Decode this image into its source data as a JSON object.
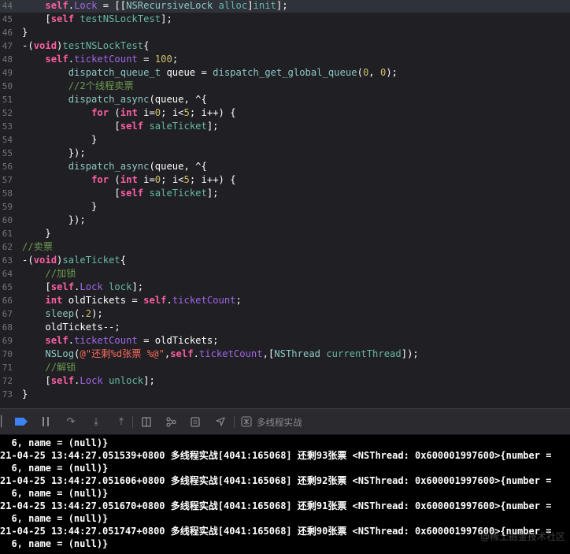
{
  "editor": {
    "lines": [
      {
        "n": "44",
        "toks": [
          [
            "    ",
            "w"
          ],
          [
            "self",
            "k"
          ],
          [
            ".",
            "w"
          ],
          [
            "Lock",
            "p"
          ],
          [
            " = [[",
            "w"
          ],
          [
            "NSRecursiveLock",
            "pr"
          ],
          [
            " ",
            "w"
          ],
          [
            "alloc",
            "m"
          ],
          [
            "]",
            "w"
          ],
          [
            "init",
            "m"
          ],
          [
            "];",
            "w"
          ]
        ]
      },
      {
        "n": "45",
        "toks": [
          [
            "    [",
            "w"
          ],
          [
            "self",
            "k"
          ],
          [
            " ",
            "w"
          ],
          [
            "testNSLockTest",
            "m"
          ],
          [
            "];",
            "w"
          ]
        ]
      },
      {
        "n": "46",
        "toks": [
          [
            "}",
            "w"
          ]
        ]
      },
      {
        "n": "47",
        "toks": [
          [
            "-(",
            "w"
          ],
          [
            "void",
            "k"
          ],
          [
            ")",
            "w"
          ],
          [
            "testNSLockTest",
            "m"
          ],
          [
            "{",
            "w"
          ]
        ]
      },
      {
        "n": "48",
        "toks": [
          [
            "    ",
            "w"
          ],
          [
            "self",
            "k"
          ],
          [
            ".",
            "w"
          ],
          [
            "ticketCount",
            "p"
          ],
          [
            " = ",
            "w"
          ],
          [
            "100",
            "n"
          ],
          [
            ";",
            "w"
          ]
        ]
      },
      {
        "n": "49",
        "toks": [
          [
            "        ",
            "w"
          ],
          [
            "dispatch_queue_t",
            "pr"
          ],
          [
            " queue = ",
            "w"
          ],
          [
            "dispatch_get_global_queue",
            "pr"
          ],
          [
            "(",
            "w"
          ],
          [
            "0",
            "n"
          ],
          [
            ", ",
            "w"
          ],
          [
            "0",
            "n"
          ],
          [
            ");",
            "w"
          ]
        ]
      },
      {
        "n": "50",
        "toks": [
          [
            "        ",
            "w"
          ],
          [
            "//2个线程卖票",
            "c"
          ]
        ]
      },
      {
        "n": "51",
        "toks": [
          [
            "        ",
            "w"
          ],
          [
            "dispatch_async",
            "pr"
          ],
          [
            "(queue, ^{",
            "w"
          ]
        ]
      },
      {
        "n": "52",
        "toks": [
          [
            "            ",
            "w"
          ],
          [
            "for",
            "k"
          ],
          [
            " (",
            "w"
          ],
          [
            "int",
            "k"
          ],
          [
            " i=",
            "w"
          ],
          [
            "0",
            "n"
          ],
          [
            "; i<",
            "w"
          ],
          [
            "5",
            "n"
          ],
          [
            "; i++) {",
            "w"
          ]
        ]
      },
      {
        "n": "53",
        "toks": [
          [
            "                [",
            "w"
          ],
          [
            "self",
            "k"
          ],
          [
            " ",
            "w"
          ],
          [
            "saleTicket",
            "m"
          ],
          [
            "];",
            "w"
          ]
        ]
      },
      {
        "n": "54",
        "toks": [
          [
            "            }",
            "w"
          ]
        ]
      },
      {
        "n": "55",
        "toks": [
          [
            "        });",
            "w"
          ]
        ]
      },
      {
        "n": "56",
        "toks": [
          [
            "        ",
            "w"
          ],
          [
            "dispatch_async",
            "pr"
          ],
          [
            "(queue, ^{",
            "w"
          ]
        ]
      },
      {
        "n": "57",
        "toks": [
          [
            "            ",
            "w"
          ],
          [
            "for",
            "k"
          ],
          [
            " (",
            "w"
          ],
          [
            "int",
            "k"
          ],
          [
            " i=",
            "w"
          ],
          [
            "0",
            "n"
          ],
          [
            "; i<",
            "w"
          ],
          [
            "5",
            "n"
          ],
          [
            "; i++) {",
            "w"
          ]
        ]
      },
      {
        "n": "58",
        "toks": [
          [
            "                [",
            "w"
          ],
          [
            "self",
            "k"
          ],
          [
            " ",
            "w"
          ],
          [
            "saleTicket",
            "m"
          ],
          [
            "];",
            "w"
          ]
        ]
      },
      {
        "n": "59",
        "toks": [
          [
            "            }",
            "w"
          ]
        ]
      },
      {
        "n": "60",
        "toks": [
          [
            "        });",
            "w"
          ]
        ]
      },
      {
        "n": "61",
        "toks": [
          [
            "    }",
            "w"
          ]
        ]
      },
      {
        "n": "62",
        "toks": [
          [
            "//卖票",
            "c"
          ]
        ]
      },
      {
        "n": "63",
        "toks": [
          [
            "-(",
            "w"
          ],
          [
            "void",
            "k"
          ],
          [
            ")",
            "w"
          ],
          [
            "saleTicket",
            "m"
          ],
          [
            "{",
            "w"
          ]
        ]
      },
      {
        "n": "64",
        "toks": [
          [
            "    ",
            "w"
          ],
          [
            "//加锁",
            "c"
          ]
        ]
      },
      {
        "n": "65",
        "toks": [
          [
            "    [",
            "w"
          ],
          [
            "self",
            "k"
          ],
          [
            ".",
            "w"
          ],
          [
            "Lock",
            "p"
          ],
          [
            " ",
            "w"
          ],
          [
            "lock",
            "m"
          ],
          [
            "];",
            "w"
          ]
        ]
      },
      {
        "n": "66",
        "toks": [
          [
            "    ",
            "w"
          ],
          [
            "int",
            "k"
          ],
          [
            " oldTickets = ",
            "w"
          ],
          [
            "self",
            "k"
          ],
          [
            ".",
            "w"
          ],
          [
            "ticketCount",
            "p"
          ],
          [
            ";",
            "w"
          ]
        ]
      },
      {
        "n": "67",
        "toks": [
          [
            "    ",
            "w"
          ],
          [
            "sleep",
            "pr"
          ],
          [
            "(.",
            "w"
          ],
          [
            "2",
            "n"
          ],
          [
            ");",
            "w"
          ]
        ]
      },
      {
        "n": "68",
        "toks": [
          [
            "    oldTickets--;",
            "w"
          ]
        ]
      },
      {
        "n": "69",
        "toks": [
          [
            "    ",
            "w"
          ],
          [
            "self",
            "k"
          ],
          [
            ".",
            "w"
          ],
          [
            "ticketCount",
            "p"
          ],
          [
            " = oldTickets;",
            "w"
          ]
        ]
      },
      {
        "n": "70",
        "toks": [
          [
            "    ",
            "w"
          ],
          [
            "NSLog",
            "pr"
          ],
          [
            "(",
            "w"
          ],
          [
            "@\"还剩%d张票 %@\"",
            "s"
          ],
          [
            ",",
            "w"
          ],
          [
            "self",
            "k"
          ],
          [
            ".",
            "w"
          ],
          [
            "ticketCount",
            "p"
          ],
          [
            ",[",
            "w"
          ],
          [
            "NSThread",
            "pr"
          ],
          [
            " ",
            "w"
          ],
          [
            "currentThread",
            "m"
          ],
          [
            "]);",
            "w"
          ]
        ]
      },
      {
        "n": "71",
        "toks": [
          [
            "    ",
            "w"
          ],
          [
            "//解锁",
            "c"
          ]
        ]
      },
      {
        "n": "72",
        "toks": [
          [
            "    [",
            "w"
          ],
          [
            "self",
            "k"
          ],
          [
            ".",
            "w"
          ],
          [
            "Lock",
            "p"
          ],
          [
            " ",
            "w"
          ],
          [
            "unlock",
            "m"
          ],
          [
            "];",
            "w"
          ]
        ]
      },
      {
        "n": "73",
        "toks": [
          [
            "}",
            "w"
          ]
        ]
      }
    ]
  },
  "debug_bar": {
    "target_label": "多线程实战"
  },
  "console": {
    "lines": [
      "  6, name = (null)}",
      "21-04-25 13:44:27.051539+0800 多线程实战[4041:165068] 还剩93张票 <NSThread: 0x600001997600>{number =",
      "  6, name = (null)}",
      "21-04-25 13:44:27.051606+0800 多线程实战[4041:165068] 还剩92张票 <NSThread: 0x600001997600>{number =",
      "  6, name = (null)}",
      "21-04-25 13:44:27.051670+0800 多线程实战[4041:165068] 还剩91张票 <NSThread: 0x600001997600>{number =",
      "  6, name = (null)}",
      "21-04-25 13:44:27.051747+0800 多线程实战[4041:165068] 还剩90张票 <NSThread: 0x600001997600>{number =",
      "  6, name = (null)}"
    ]
  },
  "watermark": "@稀土掘金技术社区"
}
